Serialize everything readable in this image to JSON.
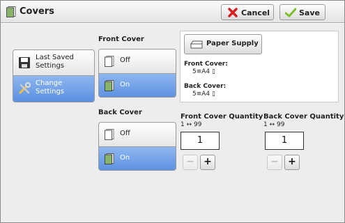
{
  "window": {
    "title": "Covers"
  },
  "toolbar": {
    "cancel_label": "Cancel",
    "save_label": "Save"
  },
  "nav": {
    "items": [
      {
        "label_line1": "Last Saved",
        "label_line2": "Settings",
        "selected": false
      },
      {
        "label_line1": "Change",
        "label_line2": "Settings",
        "selected": true
      }
    ]
  },
  "front_cover": {
    "label": "Front Cover",
    "off_label": "Off",
    "on_label": "On",
    "selected": "On"
  },
  "back_cover": {
    "label": "Back Cover",
    "off_label": "Off",
    "on_label": "On",
    "selected": "On"
  },
  "paper_supply": {
    "button_label": "Paper Supply",
    "front_label": "Front Cover:",
    "front_value": "5≡A4 ▯",
    "back_label": "Back Cover:",
    "back_value": "5≡A4 ▯"
  },
  "front_quantity": {
    "label": "Front Cover Quantity",
    "range": "1 ↔ 99",
    "value": "1",
    "minus": "−",
    "plus": "+"
  },
  "back_quantity": {
    "label": "Back Cover Quantity",
    "range": "1 ↔ 99",
    "value": "1",
    "minus": "−",
    "plus": "+"
  },
  "colors": {
    "selected": "#5a8fe0",
    "cancel_x": "#d62020",
    "save_check": "#7cbf2a"
  }
}
